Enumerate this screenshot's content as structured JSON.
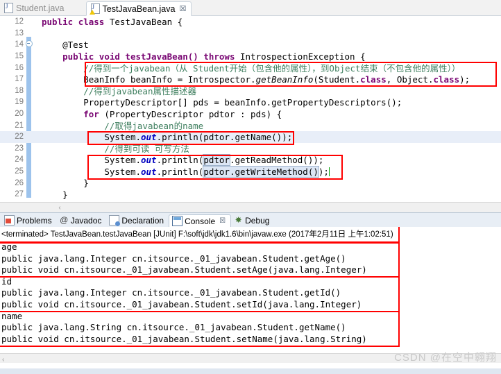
{
  "editor_tabs": [
    {
      "label": "Student.java",
      "icon": "java-file-icon",
      "active": false,
      "warning": false
    },
    {
      "label": "TestJavaBean.java",
      "icon": "java-file-warning-icon",
      "active": true,
      "warning": true,
      "close": "☒"
    }
  ],
  "code": {
    "lines": [
      {
        "num": "12",
        "fold": false
      },
      {
        "num": "13",
        "fold": false
      },
      {
        "num": "14",
        "fold": true
      },
      {
        "num": "15",
        "fold": false
      },
      {
        "num": "16",
        "fold": false
      },
      {
        "num": "17",
        "fold": false
      },
      {
        "num": "18",
        "fold": false
      },
      {
        "num": "19",
        "fold": false
      },
      {
        "num": "20",
        "fold": false
      },
      {
        "num": "21",
        "fold": false
      },
      {
        "num": "22",
        "fold": false
      },
      {
        "num": "23",
        "fold": false
      },
      {
        "num": "24",
        "fold": false
      },
      {
        "num": "25",
        "fold": false
      },
      {
        "num": "26",
        "fold": false
      },
      {
        "num": "27",
        "fold": false
      }
    ],
    "line12": {
      "kw1": "public",
      "kw2": "class",
      "name": " TestJavaBean {"
    },
    "line14": {
      "annotation": "@Test"
    },
    "line15": {
      "kw1": "public",
      "kw2": "void",
      "sig": " testJavaBean() ",
      "kw3": "throws",
      "exc": " IntrospectionException {"
    },
    "line16": {
      "comment": "//得到一个javabean（从 Student开始（包含他的属性），到Object结束（不包含他的属性））"
    },
    "line17": {
      "type": "BeanInfo",
      "var": " beanInfo = Introspector.",
      "call": "getBeanInfo",
      "args1": "(Student.",
      "kwc1": "class",
      "args2": ", Object.",
      "kwc2": "class",
      "tail": ");"
    },
    "line18": {
      "comment": "//得到javabean属性描述器"
    },
    "line19": {
      "text": "PropertyDescriptor[] pds = beanInfo.getPropertyDescriptors();"
    },
    "line20": {
      "kw": "for",
      "text": " (PropertyDescriptor pdtor : pds) {"
    },
    "line21": {
      "comment": "//取得javabean的name"
    },
    "line22": {
      "a": "System.",
      "f": "out",
      "b": ".println(pdtor.getName());"
    },
    "line23": {
      "comment": "//得到可读 可写方法"
    },
    "line24": {
      "a": "System.",
      "f": "out",
      "b": ".println(",
      "sel": "pdtor",
      "c": ".getReadMethod());"
    },
    "line25": {
      "a": "System.",
      "f": "out",
      "b": ".println(",
      "sel": "pdtor.getWriteMethod()",
      "c": ");"
    },
    "line26": {
      "text": "}"
    },
    "line27": {
      "text": "}"
    }
  },
  "view_tabs": [
    {
      "label": "Problems",
      "icon": "problems-icon",
      "active": false
    },
    {
      "label": "Javadoc",
      "icon": "javadoc-icon",
      "active": false
    },
    {
      "label": "Declaration",
      "icon": "declaration-icon",
      "active": false
    },
    {
      "label": "Console",
      "icon": "console-icon",
      "active": true,
      "close": "☒"
    },
    {
      "label": "Debug",
      "icon": "debug-icon",
      "active": false
    }
  ],
  "console": {
    "terminated": "<terminated> TestJavaBean.testJavaBean [JUnit] F:\\soft\\jdk\\jdk1.6\\bin\\javaw.exe (2017年2月11日 上午1:02:51)",
    "groups": [
      {
        "property": "age",
        "getter": "public java.lang.Integer cn.itsource._01_javabean.Student.getAge()",
        "setter": "public void cn.itsource._01_javabean.Student.setAge(java.lang.Integer)"
      },
      {
        "property": "id",
        "getter": "public java.lang.Integer cn.itsource._01_javabean.Student.getId()",
        "setter": "public void cn.itsource._01_javabean.Student.setId(java.lang.Integer)"
      },
      {
        "property": "name",
        "getter": "public java.lang.String cn.itsource._01_javabean.Student.getName()",
        "setter": "public void cn.itsource._01_javabean.Student.setName(java.lang.String)"
      }
    ]
  },
  "scroll": {
    "left_arrow": "‹"
  },
  "watermark": "CSDN @在空中翱翔",
  "colors": {
    "keyword": "#7a0874",
    "comment": "#3f7f5f",
    "field": "#0000c0",
    "annotation_box": "#ff0000",
    "highlight_line": "#e8eef8",
    "change_bar": "#9dc3ec"
  }
}
